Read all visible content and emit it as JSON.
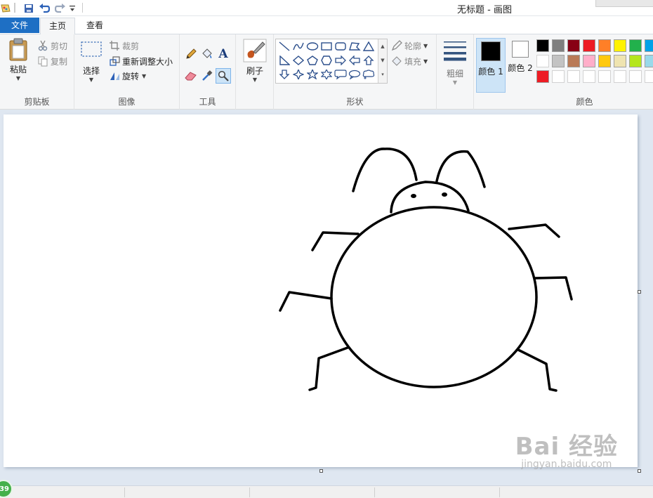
{
  "window": {
    "title": "无标题 - 画图"
  },
  "quick_access": {
    "icons": [
      "paint-app-icon",
      "save-icon",
      "undo-icon",
      "redo-icon",
      "customize-dropdown-icon"
    ]
  },
  "tabs": [
    {
      "label": "文件"
    },
    {
      "label": "主页"
    },
    {
      "label": "查看"
    }
  ],
  "ribbon": {
    "clipboard": {
      "paste": "粘贴",
      "cut": "剪切",
      "copy": "复制",
      "group": "剪贴板"
    },
    "image": {
      "select": "选择",
      "crop": "裁剪",
      "resize": "重新调整大小",
      "rotate": "旋转",
      "group": "图像"
    },
    "tools": {
      "group": "工具",
      "icons": [
        "pencil-icon",
        "fill-icon",
        "text-icon",
        "eraser-icon",
        "color-picker-icon",
        "magnifier-icon"
      ]
    },
    "brushes": {
      "label": "刷子"
    },
    "shapes": {
      "outline": "轮廓",
      "fill": "填充",
      "group": "形状"
    },
    "size": {
      "label": "粗细"
    },
    "colors": {
      "color1": "颜色 1",
      "color2": "颜色 2",
      "group": "颜色",
      "color1_value": "#000000",
      "color2_value": "#ffffff",
      "palette_row1": [
        "#000000",
        "#7f7f7f",
        "#880015",
        "#ed1c24",
        "#ff7f27",
        "#fff200",
        "#22b14c",
        "#00a2e8"
      ],
      "palette_row2": [
        "#ffffff",
        "#c3c3c3",
        "#b97a57",
        "#ffaec9",
        "#ffc90e",
        "#efe4b0",
        "#b5e61d",
        "#99d9ea"
      ],
      "palette_row3": [
        "#ed1c24",
        "#ffffff",
        "#ffffff",
        "#ffffff",
        "#ffffff",
        "#ffffff",
        "#ffffff",
        "#ffffff"
      ]
    }
  },
  "status": {
    "badge": "39"
  },
  "watermark": {
    "line1": "Bai 经验",
    "line2": "jingyan.baidu.com"
  }
}
